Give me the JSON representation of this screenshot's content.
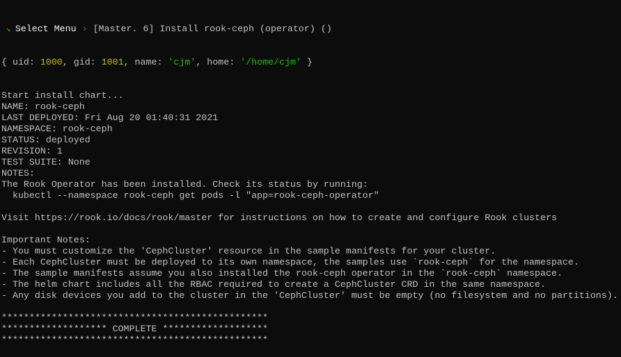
{
  "header": {
    "menu_icon": "green-arrow-icon",
    "menu_label": "Select Menu",
    "separator": "›",
    "breadcrumb": "[Master. 6] Install rook-ceph (operator) ()"
  },
  "user_info": {
    "open": "{ uid: ",
    "uid": "1000",
    "gid_label": ", gid: ",
    "gid": "1001",
    "name_label": ", name: ",
    "name": "'cjm'",
    "home_label": ", home: ",
    "home": "'/home/cjm'",
    "close": " }"
  },
  "output_lines": [
    "Start install chart...",
    "NAME: rook-ceph",
    "LAST DEPLOYED: Fri Aug 20 01:40:31 2021",
    "NAMESPACE: rook-ceph",
    "STATUS: deployed",
    "REVISION: 1",
    "TEST SUITE: None",
    "NOTES:",
    "The Rook Operator has been installed. Check its status by running:",
    "  kubectl --namespace rook-ceph get pods -l \"app=rook-ceph-operator\"",
    "",
    "Visit https://rook.io/docs/rook/master for instructions on how to create and configure Rook clusters",
    "",
    "Important Notes:",
    "- You must customize the 'CephCluster' resource in the sample manifests for your cluster.",
    "- Each CephCluster must be deployed to its own namespace, the samples use `rook-ceph` for the namespace.",
    "- The sample manifests assume you also installed the rook-ceph operator in the `rook-ceph` namespace.",
    "- The helm chart includes all the RBAC required to create a CephCluster CRD in the same namespace.",
    "- Any disk devices you add to the cluster in the 'CephCluster' must be empty (no filesystem and no partitions).",
    "",
    "************************************************",
    "******************* COMPLETE *******************",
    "************************************************"
  ],
  "colors": {
    "background": "#0c0c0c",
    "text": "#c0c0c0",
    "number": "#c1c100",
    "string": "#16c60c"
  }
}
